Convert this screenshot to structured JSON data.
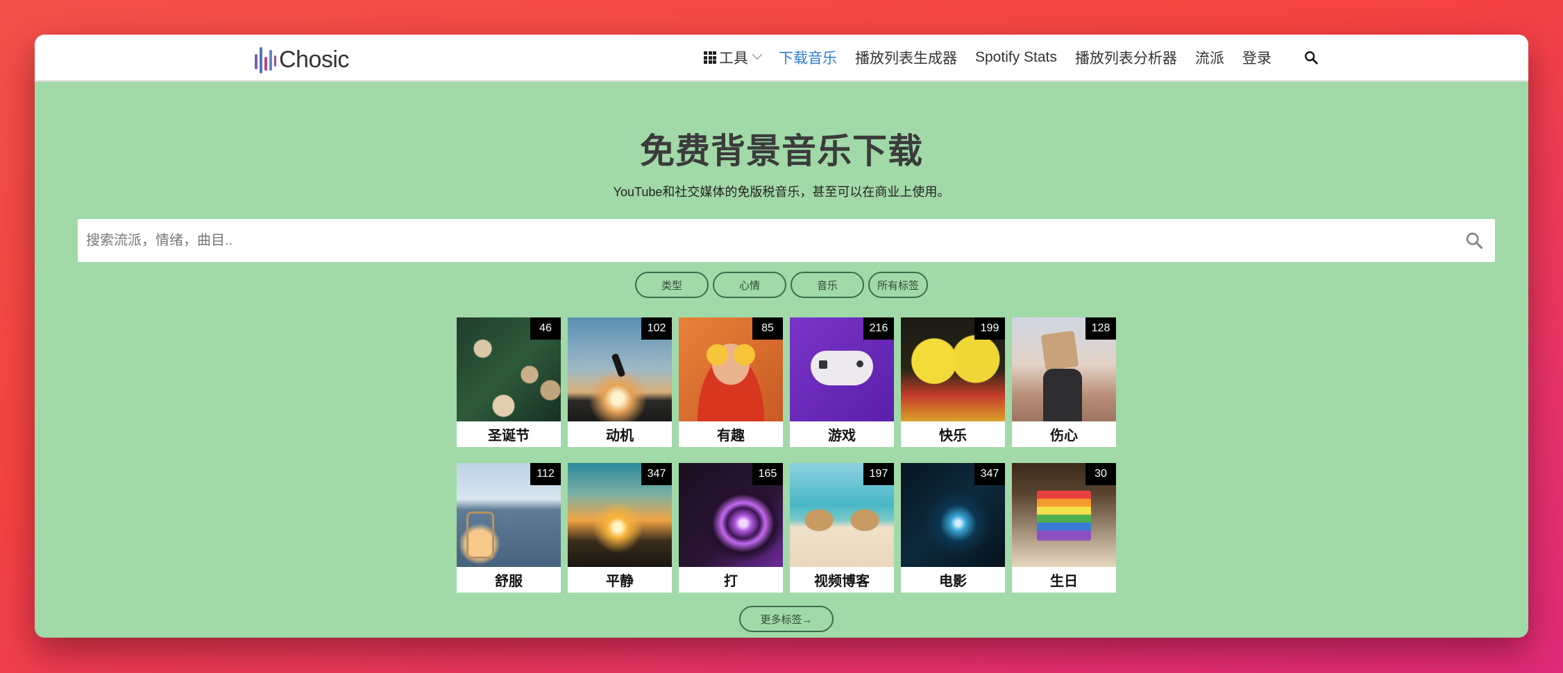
{
  "brand": {
    "name": "Chosic"
  },
  "nav": {
    "tools_label": "工具",
    "items": [
      {
        "label": "下载音乐",
        "active": true
      },
      {
        "label": "播放列表生成器",
        "active": false
      },
      {
        "label": "Spotify Stats",
        "active": false
      },
      {
        "label": "播放列表分析器",
        "active": false
      },
      {
        "label": "流派",
        "active": false
      },
      {
        "label": "登录",
        "active": false
      }
    ]
  },
  "hero": {
    "title": "免费背景音乐下载",
    "subtitle": "YouTube和社交媒体的免版税音乐，甚至可以在商业上使用。"
  },
  "search": {
    "placeholder": "搜索流派，情绪，曲目.."
  },
  "filters": [
    "类型",
    "心情",
    "音乐",
    "所有标签"
  ],
  "tiles": [
    {
      "label": "圣诞节",
      "count": "46",
      "icon": "christmas-image"
    },
    {
      "label": "动机",
      "count": "102",
      "icon": "motivation-image"
    },
    {
      "label": "有趣",
      "count": "85",
      "icon": "funny-image"
    },
    {
      "label": "游戏",
      "count": "216",
      "icon": "gaming-image"
    },
    {
      "label": "快乐",
      "count": "199",
      "icon": "happy-image"
    },
    {
      "label": "伤心",
      "count": "128",
      "icon": "sad-image"
    },
    {
      "label": "舒服",
      "count": "112",
      "icon": "relaxing-image"
    },
    {
      "label": "平静",
      "count": "347",
      "icon": "calm-image"
    },
    {
      "label": "打",
      "count": "165",
      "icon": "beat-image"
    },
    {
      "label": "视频博客",
      "count": "197",
      "icon": "vlog-image"
    },
    {
      "label": "电影",
      "count": "347",
      "icon": "cinematic-image"
    },
    {
      "label": "生日",
      "count": "30",
      "icon": "birthday-image"
    }
  ],
  "more_tags": "更多标签→",
  "colors": {
    "page_bg": "#a1d9a8",
    "nav_active": "#2b7bd8",
    "outer_gradient": [
      "#f4504a",
      "#e02a78"
    ]
  }
}
